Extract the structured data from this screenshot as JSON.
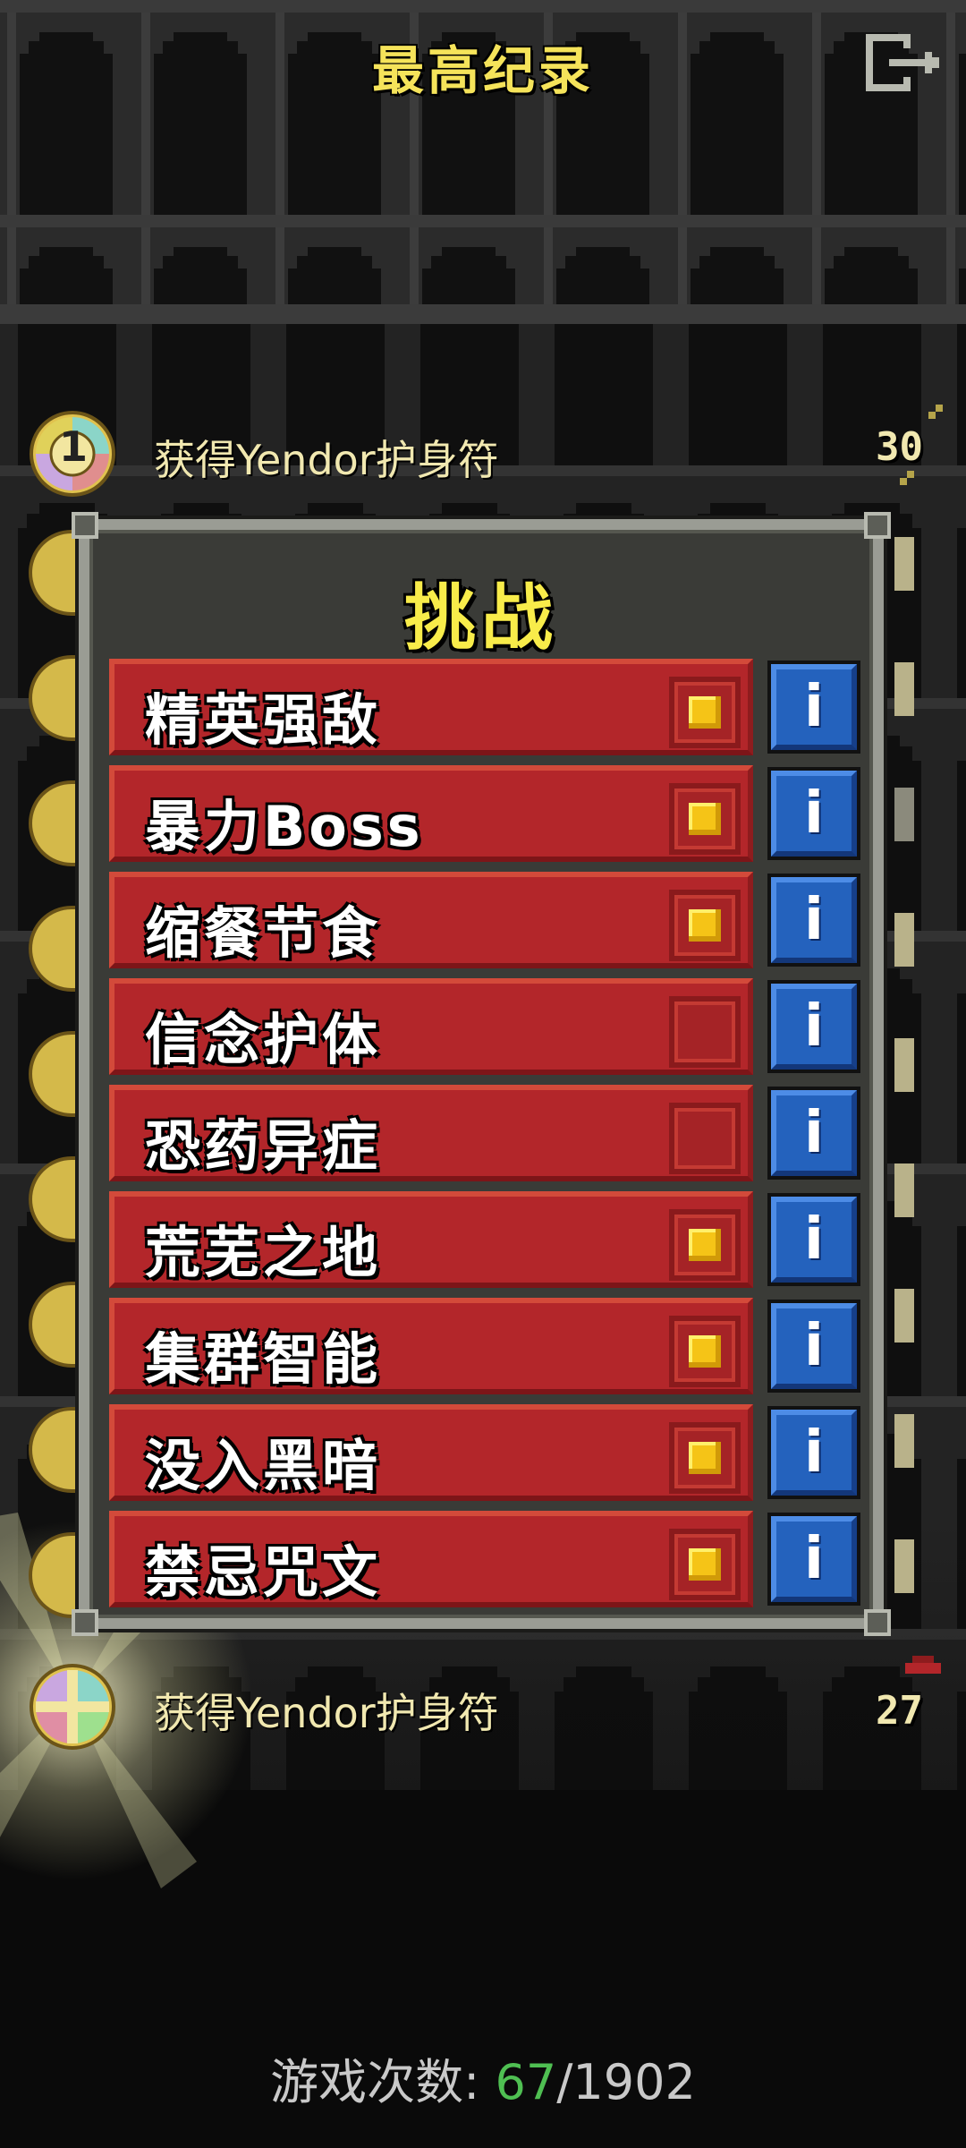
{
  "header": {
    "title": "最高纪录"
  },
  "records_top": [
    {
      "rank": "1",
      "text": "获得Yendor护身符",
      "score": "30"
    }
  ],
  "records_bottom": [
    {
      "text": "获得Yendor护身符",
      "score": "27"
    }
  ],
  "challenges_dialog": {
    "title": "挑战",
    "info_label": "i",
    "items": [
      {
        "label": "精英强敌",
        "checked": true
      },
      {
        "label": "暴力Boss",
        "checked": true
      },
      {
        "label": "缩餐节食",
        "checked": true
      },
      {
        "label": "信念护体",
        "checked": false
      },
      {
        "label": "恐药异症",
        "checked": false
      },
      {
        "label": "荒芜之地",
        "checked": true
      },
      {
        "label": "集群智能",
        "checked": true
      },
      {
        "label": "没入黑暗",
        "checked": true
      },
      {
        "label": "禁忌咒文",
        "checked": true
      }
    ]
  },
  "footer": {
    "label": "游戏次数:",
    "won": "67",
    "total": "/1902"
  },
  "colors": {
    "title": "#f5e35a",
    "challenge_bg": "#b3262a",
    "checkbox_on": "#f5c417",
    "info_bg": "#2462bd",
    "won": "#4fbf52"
  }
}
